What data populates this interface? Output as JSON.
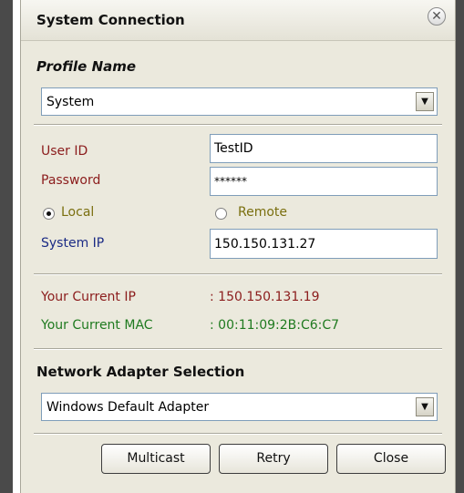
{
  "window": {
    "title": "System Connection"
  },
  "profile": {
    "label": "Profile Name",
    "selected": "System"
  },
  "login": {
    "user_id_label": "User ID",
    "user_id_value": "TestID",
    "password_label": "Password",
    "password_value": "******",
    "local_label": "Local",
    "remote_label": "Remote",
    "selected_mode": "Local",
    "system_ip_label": "System IP",
    "system_ip_value": "150.150.131.27"
  },
  "info": {
    "current_ip_label": "Your Current IP",
    "current_ip_value": ":  150.150.131.19",
    "current_mac_label": "Your Current MAC",
    "current_mac_value": ":  00:11:09:2B:C6:C7"
  },
  "adapter": {
    "label": "Network Adapter Selection",
    "selected": "Windows Default Adapter"
  },
  "buttons": {
    "multicast": "Multicast",
    "retry": "Retry",
    "close": "Close"
  },
  "icons": {
    "close": "close-icon",
    "dropdown": "chevron-down-icon"
  }
}
